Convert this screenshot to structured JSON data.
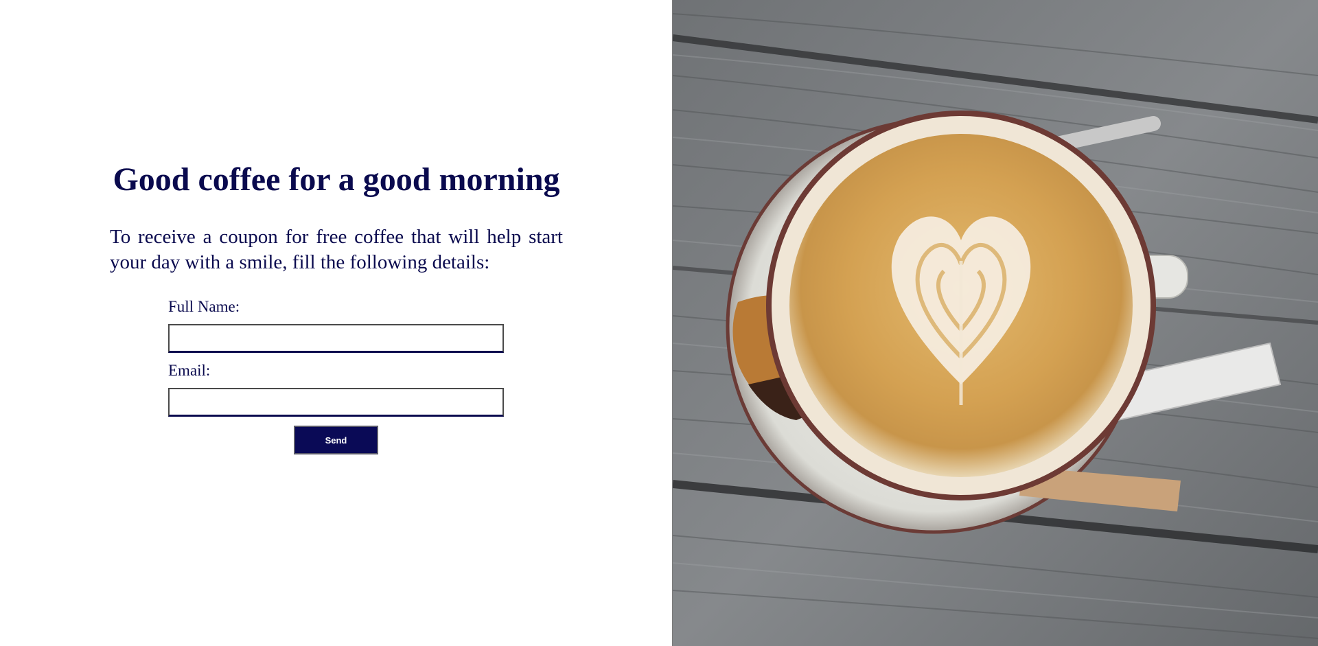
{
  "heading": "Good coffee for a good morning",
  "intro": "To receive a coupon for free coffee that will help start your day with a smile, fill the following details:",
  "form": {
    "full_name_label": "Full Name:",
    "full_name_value": "",
    "email_label": "Email:",
    "email_value": "",
    "send_label": "Send"
  },
  "photo": {
    "icon": "coffee-latte-photo"
  },
  "colors": {
    "text": "#0a0a4e",
    "button_bg": "#0a0a56",
    "button_text": "#ffffff",
    "wood": "#777a7e",
    "coffee": "#d4a55a"
  }
}
